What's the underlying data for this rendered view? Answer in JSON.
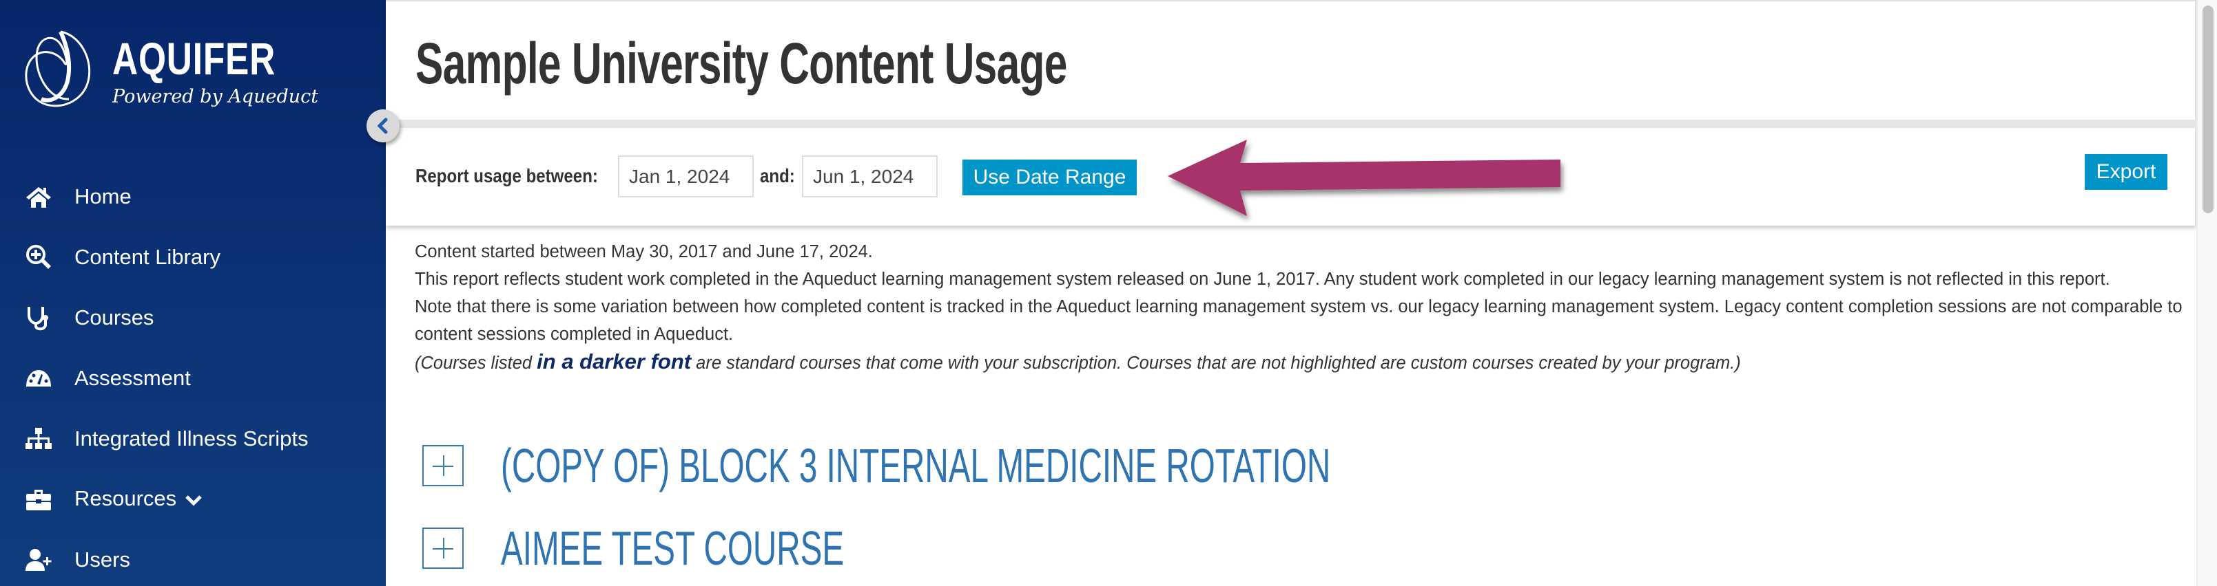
{
  "sidebar": {
    "brand": {
      "name": "AQUIFER",
      "tagline": "Powered by Aqueduct",
      "logo_icon": "aquifer-swirl-logo"
    },
    "collapse_icon": "chevron-left-icon",
    "items": [
      {
        "label": "Home",
        "icon": "home-icon"
      },
      {
        "label": "Content Library",
        "icon": "search-plus-icon"
      },
      {
        "label": "Courses",
        "icon": "stethoscope-icon"
      },
      {
        "label": "Assessment",
        "icon": "gauge-icon"
      },
      {
        "label": "Integrated Illness Scripts",
        "icon": "sitemap-icon"
      },
      {
        "label": "Resources",
        "icon": "toolbox-icon",
        "has_dropdown": true
      },
      {
        "label": "Users",
        "icon": "user-plus-icon"
      }
    ]
  },
  "header": {
    "title": "Sample University Content Usage"
  },
  "filter": {
    "label": "Report usage between:",
    "start_date": "Jan 1, 2024",
    "and_label": "and:",
    "end_date": "Jun 1, 2024",
    "use_range_button": "Use Date Range",
    "export_button": "Export",
    "annotation_arrow_color": "#a8336a"
  },
  "info": {
    "line1": "Content started between May 30, 2017 and June 17, 2024.",
    "line2": "This report reflects student work completed in the Aqueduct learning management system released on June 1, 2017. Any student work completed in our legacy learning management system is not reflected in this report.",
    "line3": "Note that there is some variation between how completed content is tracked in the Aqueduct learning management system vs. our legacy learning management system. Legacy content completion sessions are not comparable to content sessions completed in Aqueduct.",
    "legend_prefix": "(Courses listed ",
    "legend_highlight": "in a darker font",
    "legend_suffix": " are standard courses that come with your subscription. Courses that are not highlighted are custom courses created by your program.)"
  },
  "courses": [
    {
      "title": "(COPY OF) BLOCK 3 INTERNAL MEDICINE ROTATION",
      "expand_icon": "plus-square-icon"
    },
    {
      "title": "AIMEE TEST COURSE",
      "expand_icon": "plus-square-icon"
    }
  ],
  "colors": {
    "sidebar_bg": "#0a2f70",
    "primary_button": "#0094c9",
    "course_title": "#2f74b0",
    "darker_font": "#0d2a66",
    "arrow": "#a8336a"
  }
}
